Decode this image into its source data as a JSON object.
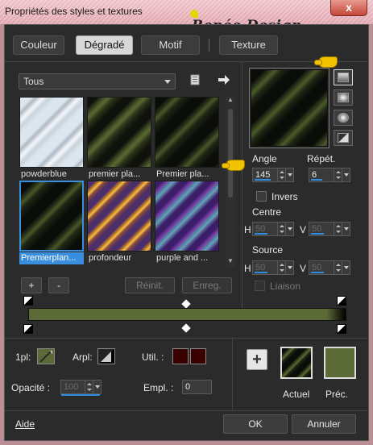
{
  "window": {
    "title": "Propriétés des styles et textures",
    "watermark": "Renée Design",
    "close_symbol": "x"
  },
  "tabs": [
    {
      "label": "Couleur",
      "active": false
    },
    {
      "label": "Dégradé",
      "active": true
    },
    {
      "label": "Motif",
      "active": false
    },
    {
      "label": "Texture",
      "active": false
    }
  ],
  "library": {
    "category": "Tous",
    "icons": [
      "folder-icon",
      "arrow-right-icon"
    ],
    "thumbnails": [
      {
        "label": "powderblue",
        "selected": false
      },
      {
        "label": "premier pla...",
        "selected": false
      },
      {
        "label": "Premier pla...",
        "selected": false
      },
      {
        "label": "Premierplan...",
        "selected": true
      },
      {
        "label": "profondeur",
        "selected": false
      },
      {
        "label": "purple and ...",
        "selected": false
      }
    ]
  },
  "buttons": {
    "add": "+",
    "remove": "-",
    "reset": "Réinit.",
    "save": "Enreg.",
    "big_add": "+",
    "ok": "OK",
    "cancel": "Annuler",
    "help": "Aide"
  },
  "gradient": {
    "start_color": "#5c6a38",
    "end_color": "#000000"
  },
  "props": {
    "angle_label": "Angle",
    "angle_value": "145",
    "repeat_label": "Répét.",
    "repeat_value": "6",
    "invert_label": "Invers",
    "center_label": "Centre",
    "center_h_label": "H",
    "center_h": "50",
    "center_v_label": "V",
    "center_v": "50",
    "source_label": "Source",
    "source_h_label": "H",
    "source_h": "50",
    "source_v_label": "V",
    "source_v": "50",
    "link_label": "Liaison"
  },
  "bottom": {
    "ipl_label": "1pl:",
    "arpl_label": "Arpl:",
    "util_label": "Util. :",
    "opacity_label": "Opacité :",
    "opacity_value": "100",
    "empl_label": "Empl. :",
    "empl_value": "0",
    "current_label": "Actuel",
    "previous_label": "Préc."
  },
  "colors": {
    "accent": "#3a8ede",
    "olive": "#5c6a38",
    "dark_red": "#3a0000",
    "panel": "#2b2b2b"
  }
}
